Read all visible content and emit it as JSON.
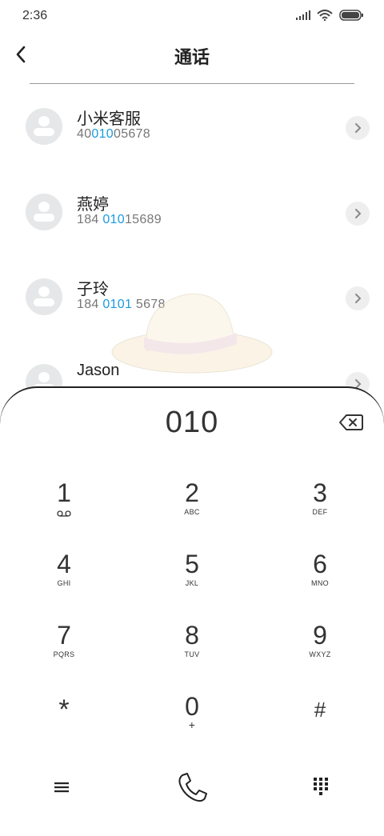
{
  "status": {
    "time": "2:36"
  },
  "header": {
    "title": "通话"
  },
  "contacts": [
    {
      "name": "小米客服",
      "number_parts": [
        "40",
        "010",
        "05678"
      ]
    },
    {
      "name": "燕婷",
      "number_parts": [
        "184 ",
        "010",
        "15689"
      ]
    },
    {
      "name": "子玲",
      "number_parts": [
        "184 ",
        "0101",
        " 5678"
      ]
    },
    {
      "name": "Jason"
    }
  ],
  "dialer": {
    "typed": "010",
    "keys": [
      {
        "digit": "1",
        "letters": ""
      },
      {
        "digit": "2",
        "letters": "ABC"
      },
      {
        "digit": "3",
        "letters": "DEF"
      },
      {
        "digit": "4",
        "letters": "GHI"
      },
      {
        "digit": "5",
        "letters": "JKL"
      },
      {
        "digit": "6",
        "letters": "MNO"
      },
      {
        "digit": "7",
        "letters": "PQRS"
      },
      {
        "digit": "8",
        "letters": "TUV"
      },
      {
        "digit": "9",
        "letters": "WXYZ"
      },
      {
        "digit": "*",
        "letters": ""
      },
      {
        "digit": "0",
        "letters": "+"
      },
      {
        "digit": "#",
        "letters": ""
      }
    ]
  },
  "icons": {
    "back": "chevron-left-icon",
    "contact_action": "chevron-right-icon",
    "delete": "backspace-icon",
    "menu": "menu-icon",
    "call": "phone-icon",
    "keypad": "keypad-grid-icon",
    "voicemail": "voicemail-icon"
  },
  "colors": {
    "highlight": "#1a9be0",
    "avatar_bg": "#e6e7e9"
  }
}
